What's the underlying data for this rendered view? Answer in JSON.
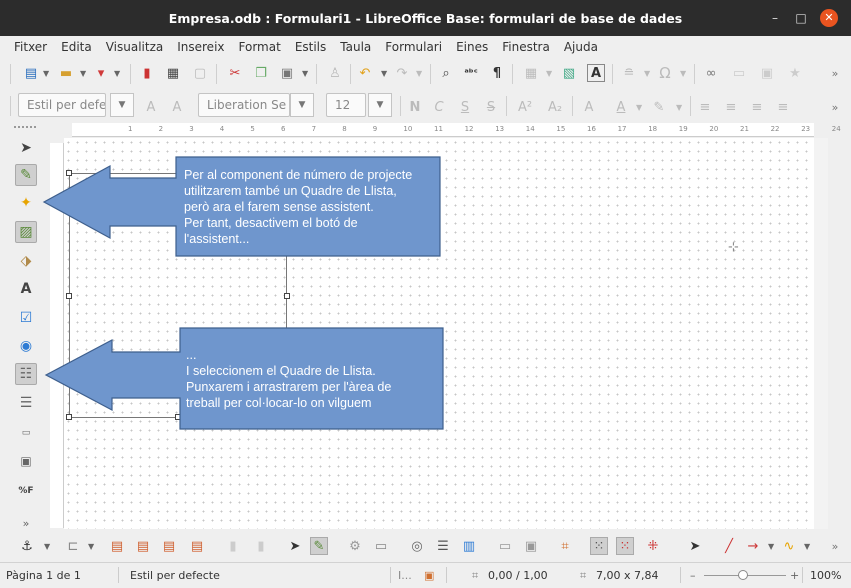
{
  "window": {
    "title": "Empresa.odb : Formulari1 - LibreOffice Base: formulari de base de dades",
    "minimize_glyph": "–",
    "maximize_glyph": "□",
    "close_glyph": "✕"
  },
  "menubar": [
    "Fitxer",
    "Edita",
    "Visualitza",
    "Insereix",
    "Format",
    "Estils",
    "Taula",
    "Formulari",
    "Eines",
    "Finestra",
    "Ajuda"
  ],
  "formatting": {
    "paragraph_style": "Estil per defe",
    "font_name": "Liberation Se",
    "font_size": "12"
  },
  "ruler": [
    "1",
    "2",
    "3",
    "4",
    "5",
    "6",
    "7",
    "8",
    "9",
    "10",
    "11",
    "12",
    "13",
    "14",
    "15",
    "16",
    "17",
    "18",
    "19",
    "20",
    "21",
    "22",
    "23",
    "24"
  ],
  "callouts": [
    {
      "text": "Per al component de número de projecte\nutilitzarem també un Quadre de Llista,\nperò ara el farem sense assistent.\nPer tant, desactivem el botó de\nl'assistent..."
    },
    {
      "text": "...\nI seleccionem el Quadre de Llista.\nPunxarem i arrastrarem per l'àrea de\ntreball per col·locar-lo on vilguem"
    }
  ],
  "statusbar": {
    "page": "Pàgina 1 de 1",
    "style": "Estil per defecte",
    "position": "0,00 / 1,00",
    "size": "7,00 x 7,84",
    "zoom": "100%"
  },
  "colors": {
    "callout_fill": "#6f96cd",
    "callout_stroke": "#3e5f8d",
    "titlebar": "#2c2c2c",
    "close_button": "#e95420"
  }
}
